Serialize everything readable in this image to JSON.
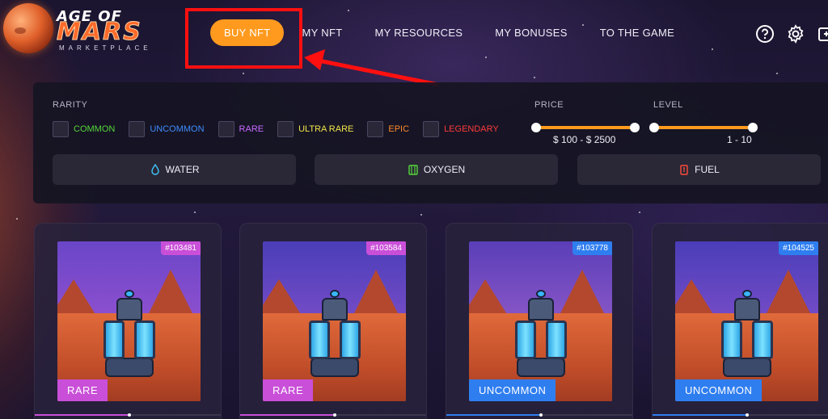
{
  "logo": {
    "title": "AGE OF",
    "mars": "MARS",
    "subtitle": "MARKETPLACE"
  },
  "nav": {
    "items": [
      {
        "label": "BUY NFT",
        "active": true
      },
      {
        "label": "MY NFT"
      },
      {
        "label": "MY RESOURCES"
      },
      {
        "label": "MY BONUSES"
      },
      {
        "label": "TO THE GAME"
      }
    ]
  },
  "header_icons": [
    "help-icon",
    "gear-icon",
    "wallet-icon"
  ],
  "filters": {
    "rarity_label": "RARITY",
    "rarities": [
      {
        "label": "COMMON",
        "color": "#54d63a"
      },
      {
        "label": "UNCOMMON",
        "color": "#3e8cff"
      },
      {
        "label": "RARE",
        "color": "#c66bff"
      },
      {
        "label": "ULTRA RARE",
        "color": "#f2e54a"
      },
      {
        "label": "EPIC",
        "color": "#ff8a2a"
      },
      {
        "label": "LEGENDARY",
        "color": "#ff3a3a"
      }
    ],
    "price_label": "PRICE",
    "price_range": "$ 100 - $ 2500",
    "level_label": "LEVEL",
    "level_range": "1 - 10",
    "resources": [
      {
        "label": "WATER",
        "icon": "water-drop-icon",
        "color": "#3ec8ff"
      },
      {
        "label": "OXYGEN",
        "icon": "oxygen-tank-icon",
        "color": "#54d63a"
      },
      {
        "label": "FUEL",
        "icon": "fuel-can-icon",
        "color": "#ff4a3a"
      }
    ]
  },
  "cards": [
    {
      "id": "#103481",
      "rarity": "RARE",
      "badge_color": "#c94fd8",
      "sky_top": "#6a46c8",
      "sky_bottom": "#b25ad6"
    },
    {
      "id": "#103584",
      "rarity": "RARE",
      "badge_color": "#c94fd8",
      "sky_top": "#4a3eb8",
      "sky_bottom": "#a25ad6"
    },
    {
      "id": "#103778",
      "rarity": "UNCOMMON",
      "badge_color": "#2f7ef0",
      "sky_top": "#5a3eb8",
      "sky_bottom": "#b870d6"
    },
    {
      "id": "#104525",
      "rarity": "UNCOMMON",
      "badge_color": "#2f7ef0",
      "sky_top": "#4a3eb8",
      "sky_bottom": "#a25ad6"
    }
  ],
  "colors": {
    "accent": "#ff9a1f",
    "highlight": "#ff1010"
  }
}
